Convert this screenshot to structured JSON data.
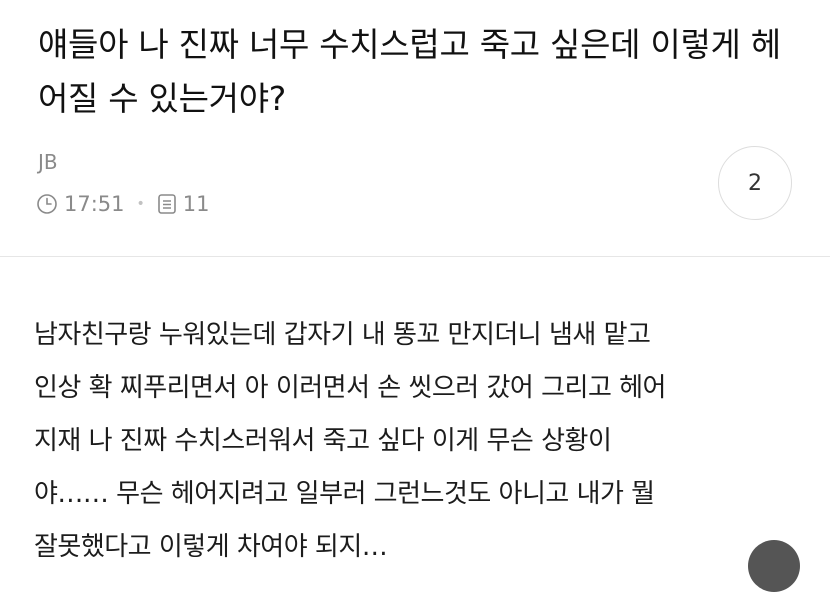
{
  "post": {
    "title": "얘들아 나 진짜 너무 수치스럽고 죽고 싶은데 이렇게 헤어질 수 있는거야?",
    "author": "JB",
    "time": "17:51",
    "views": "11",
    "comment_count": "2",
    "body_lines": [
      "남자친구랑 누워있는데 갑자기 내 똥꼬 만지더니 냄새 맡고",
      "인상 확 찌푸리면서 아 이러면서 손 씻으러 갔어 그리고 헤어",
      "지재 나 진짜 수치스러워서 죽고 싶다 이게 무슨 상황이",
      "야…… 무슨 헤어지려고 일부러 그런느것도 아니고 내가 뭘",
      "잘못했다고 이렇게 차여야 되지…"
    ]
  },
  "icons": {
    "time": "clock-icon",
    "views": "document-icon"
  },
  "colors": {
    "text": "#1c1c1c",
    "muted": "#8a8a8a",
    "divider": "#e6e6e6",
    "floating_button": "#555555"
  }
}
